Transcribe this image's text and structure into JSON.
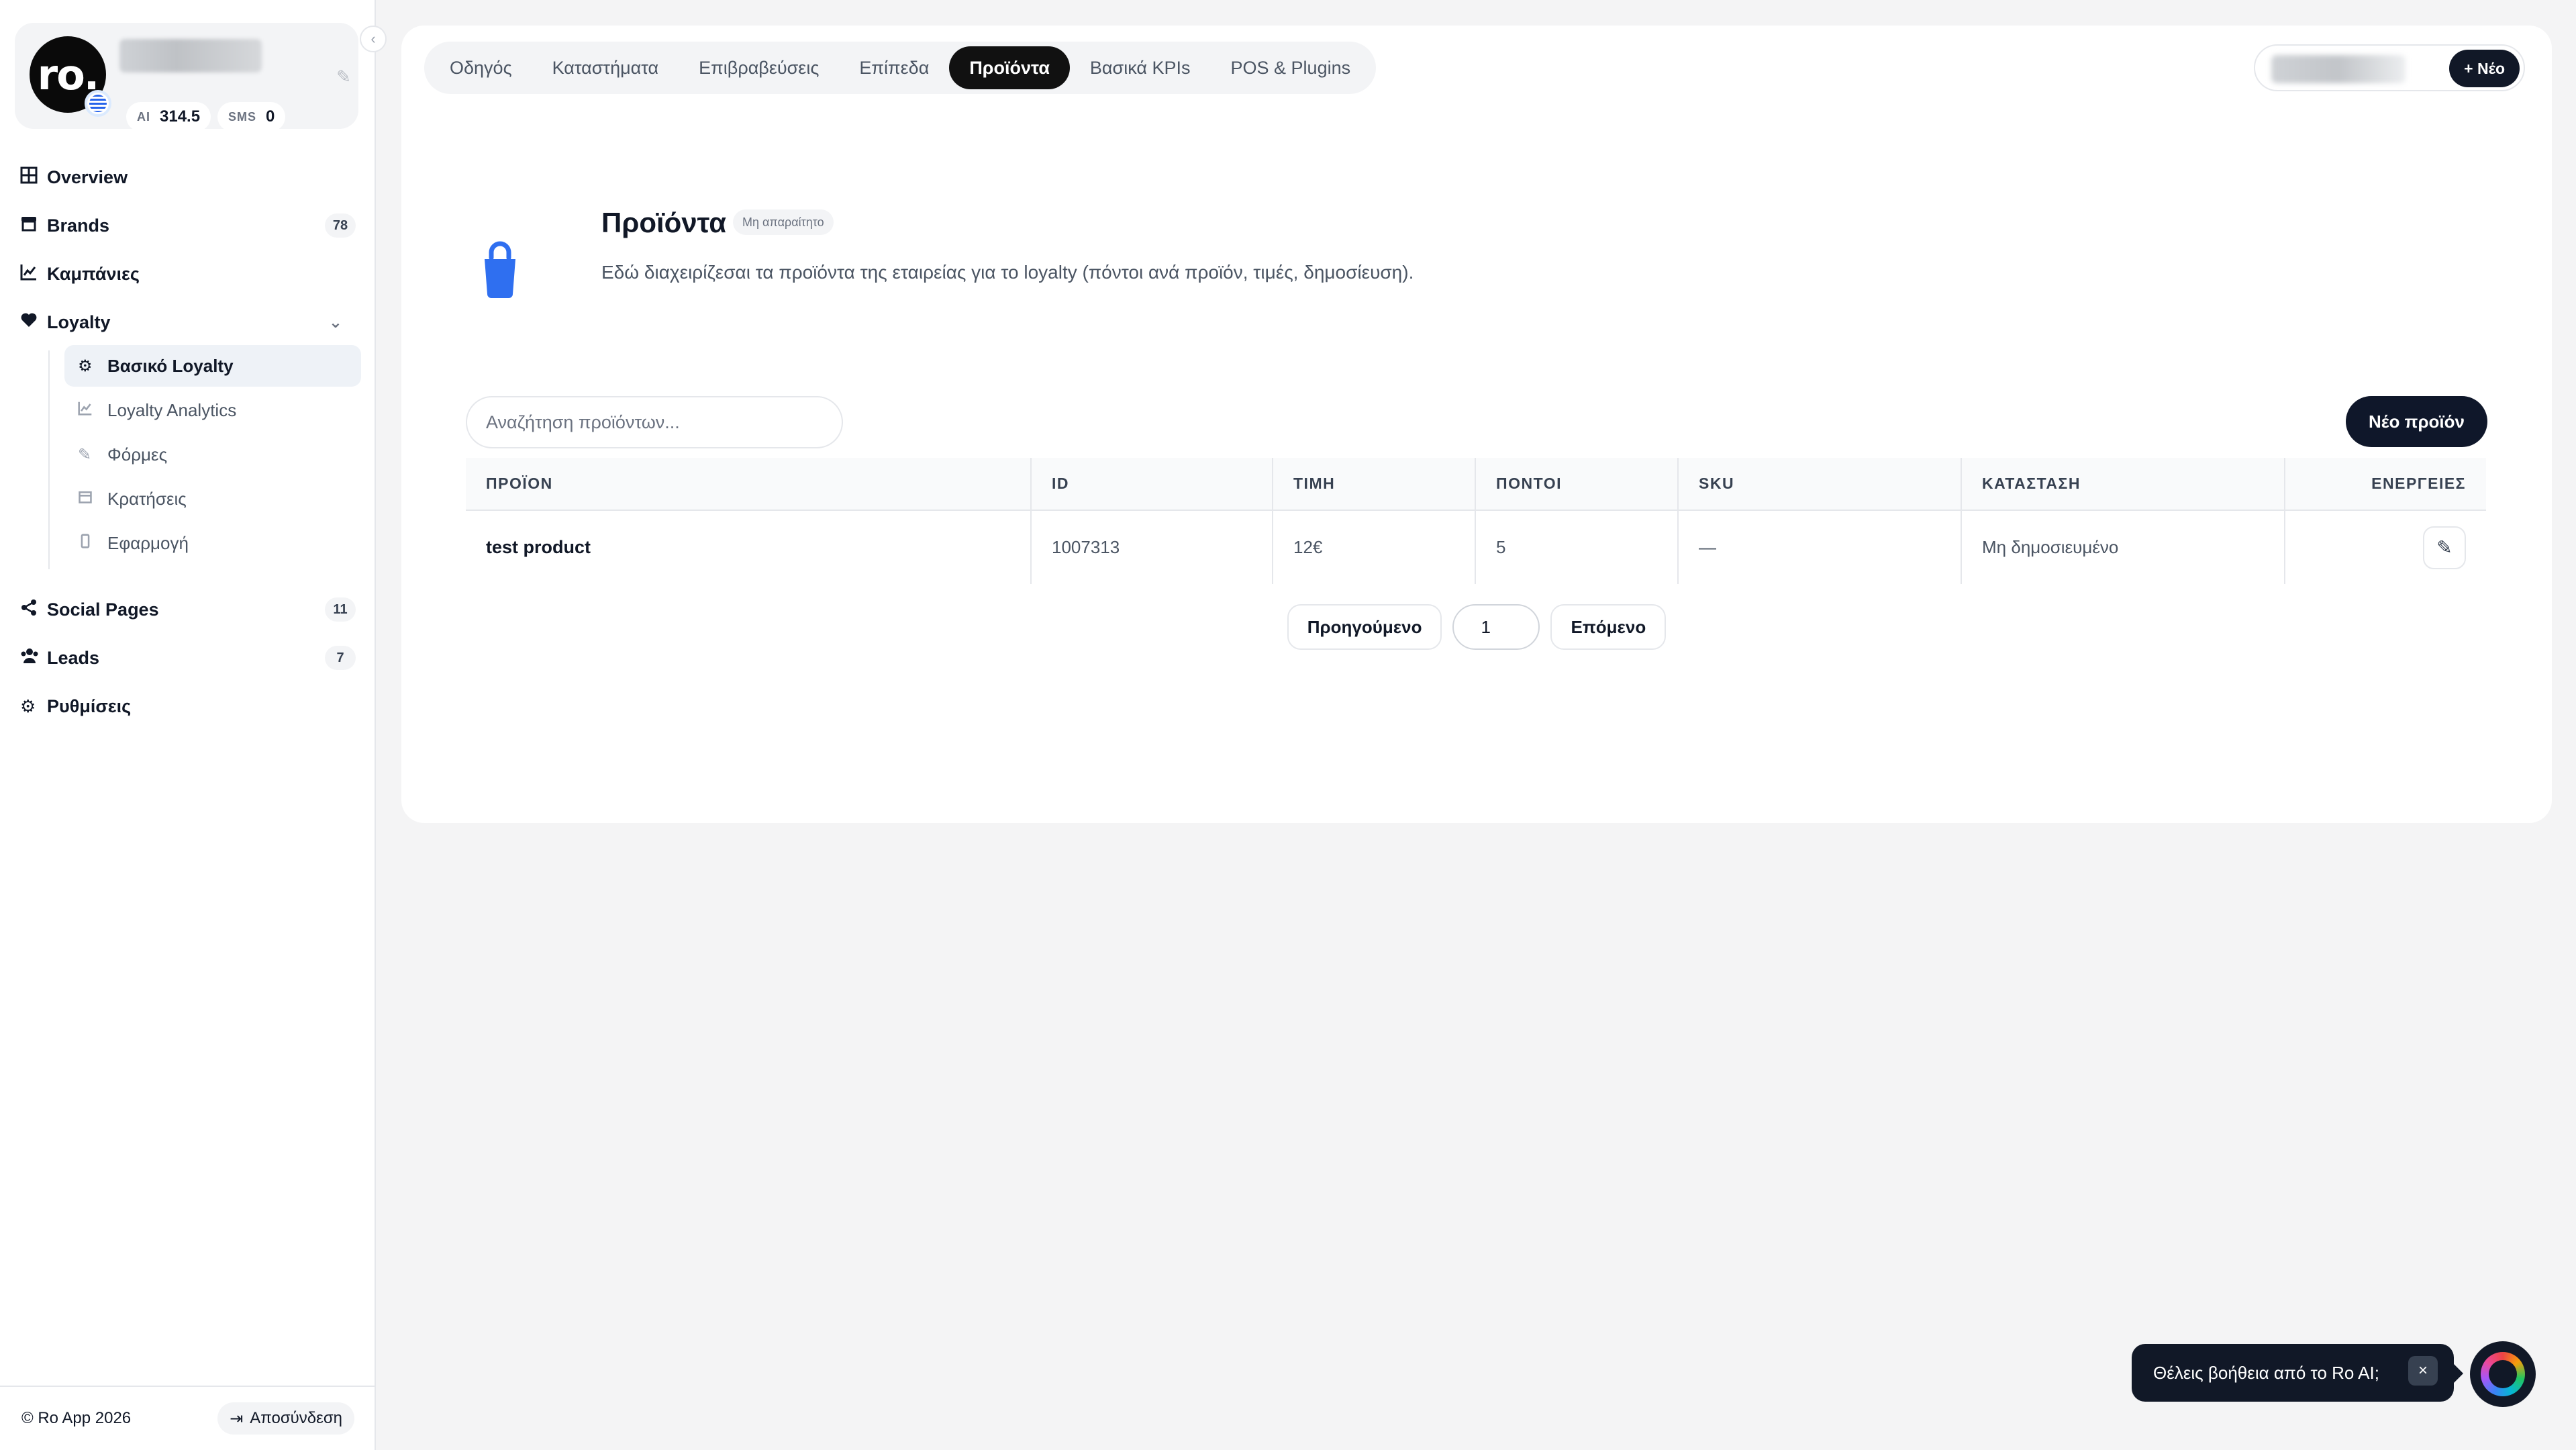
{
  "sidebar": {
    "avatar_text": "ro.",
    "credits": [
      {
        "label": "AI",
        "value": "314.5"
      },
      {
        "label": "SMS",
        "value": "0"
      }
    ],
    "nav": {
      "overview": "Overview",
      "brands": "Brands",
      "brands_count": "78",
      "campaigns": "Καμπάνιες",
      "loyalty": "Loyalty",
      "social_pages": "Social Pages",
      "social_pages_count": "11",
      "leads": "Leads",
      "leads_count": "7",
      "settings": "Ρυθμίσεις"
    },
    "loyalty_sub": [
      {
        "label": "Βασικό Loyalty",
        "icon": "cogs-icon",
        "active": true
      },
      {
        "label": "Loyalty Analytics",
        "icon": "chart-line-icon",
        "active": false
      },
      {
        "label": "Φόρμες",
        "icon": "edit-icon",
        "active": false
      },
      {
        "label": "Κρατήσεις",
        "icon": "calendar-icon",
        "active": false
      },
      {
        "label": "Εφαρμογή",
        "icon": "mobile-icon",
        "active": false
      }
    ],
    "footer": {
      "copyright": "© Ro App  2026",
      "logout": "Αποσύνδεση"
    }
  },
  "tabs": [
    {
      "label": "Οδηγός",
      "active": false
    },
    {
      "label": "Καταστήματα",
      "active": false
    },
    {
      "label": "Επιβραβεύσεις",
      "active": false
    },
    {
      "label": "Επίπεδα",
      "active": false
    },
    {
      "label": "Προϊόντα",
      "active": true
    },
    {
      "label": "Βασικά KPIs",
      "active": false
    },
    {
      "label": "POS & Plugins",
      "active": false
    }
  ],
  "top_right": {
    "new_label": "+ Νέο"
  },
  "section": {
    "title": "Προϊόντα",
    "badge": "Μη απαραίτητο",
    "description": "Εδώ διαχειρίζεσαι τα προϊόντα της εταιρείας για το loyalty (πόντοι ανά προϊόν, τιμές, δημοσίευση).",
    "icon": "shopping-bag-icon",
    "icon_color": "#2f6ff0"
  },
  "search": {
    "placeholder": "Αναζήτηση προϊόντων...",
    "value": ""
  },
  "new_product_label": "Νέο προϊόν",
  "table": {
    "columns": [
      "ΠΡΟΪΟΝ",
      "ID",
      "ΤΙΜΗ",
      "ΠΟΝΤΟΙ",
      "SKU",
      "ΚΑΤΑΣΤΑΣΗ",
      "ΕΝΕΡΓΕΙΕΣ"
    ],
    "rows": [
      {
        "product": "test product",
        "id": "1007313",
        "price": "12€",
        "points": "5",
        "sku": "—",
        "status": "Μη δημοσιευμένο"
      }
    ]
  },
  "pagination": {
    "prev": "Προηγούμενο",
    "page": "1",
    "next": "Επόμενο"
  },
  "ai_help": {
    "text": "Θέλεις βοήθεια από το Ro AI;",
    "close": "×"
  },
  "colors": {
    "accent_dark": "#111827",
    "background": "#f4f4f5",
    "bag_blue": "#2f6ff0"
  }
}
